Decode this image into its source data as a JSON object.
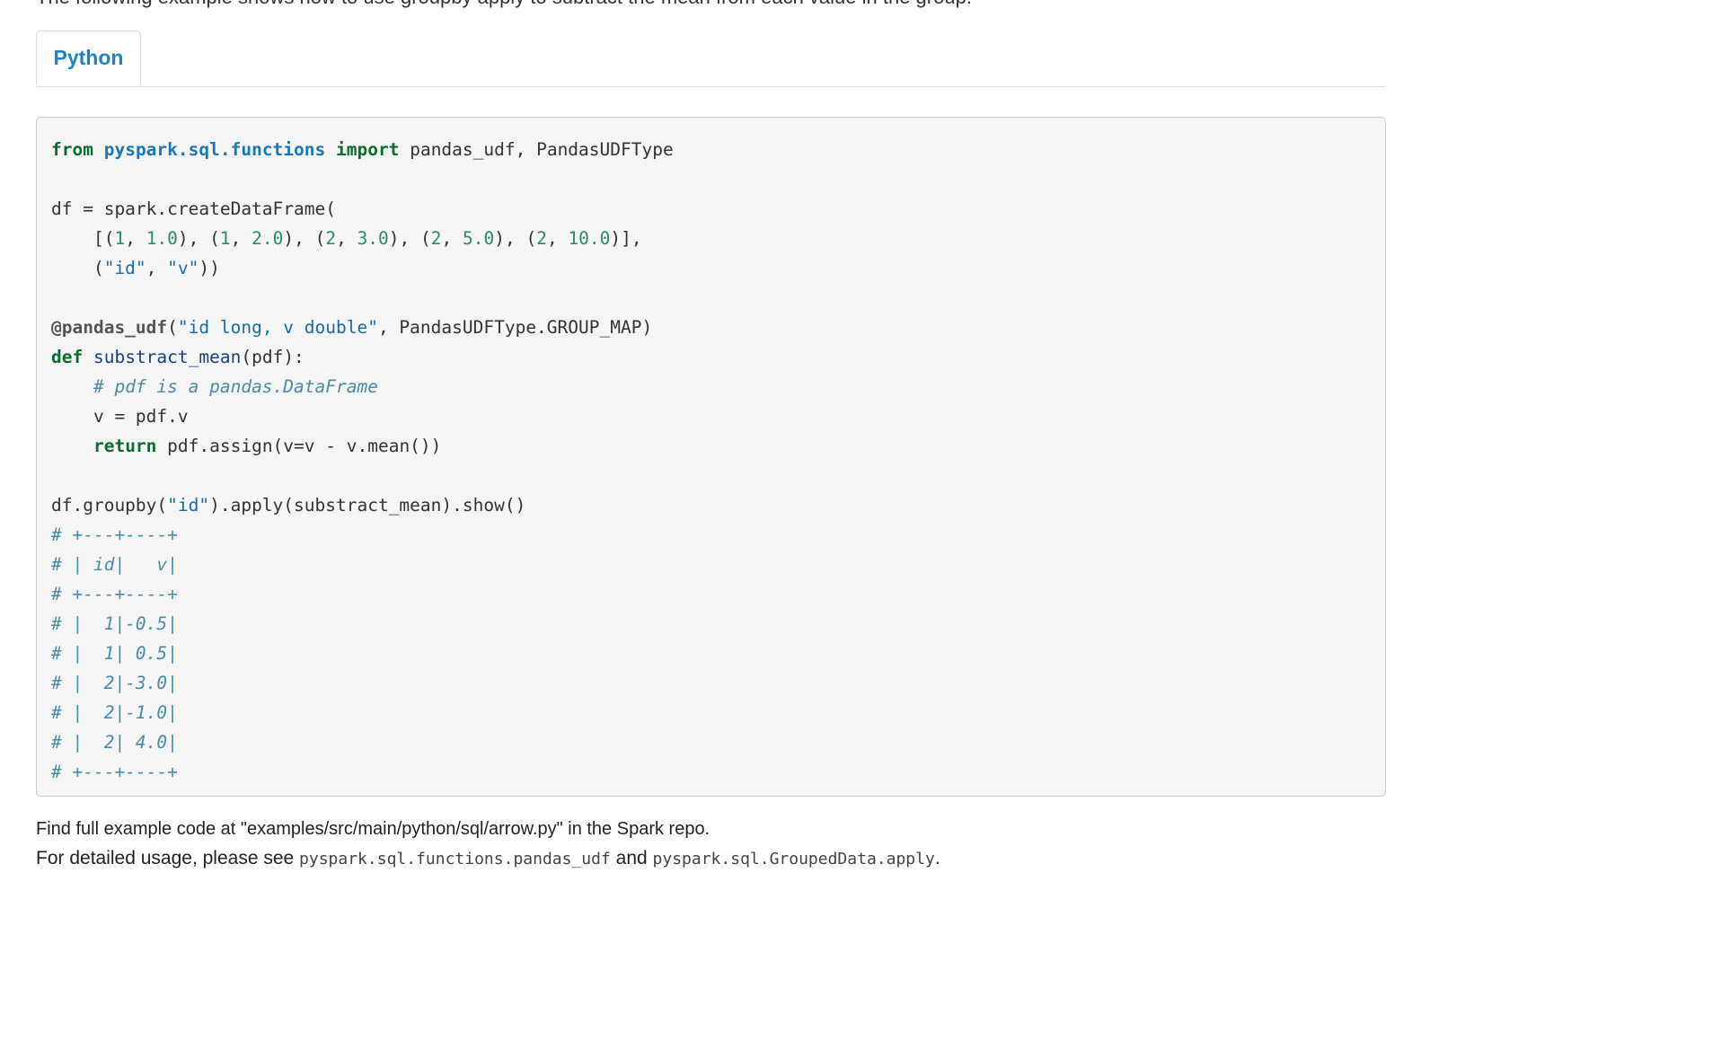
{
  "intro_text": "The following example shows how to use groupby apply to subtract the mean from each value in the group.",
  "tabs": [
    {
      "label": "Python",
      "active": true
    }
  ],
  "code": {
    "l1": {
      "kw_from": "from",
      "module": "pyspark.sql.functions",
      "kw_import": "import",
      "rest": " pandas_udf, PandasUDFType"
    },
    "l3": "df = spark.createDataFrame(",
    "l4": {
      "open": "    [(",
      "a1": "1",
      "sep1": ", ",
      "b1": "1.0",
      "c1": "), (",
      "a2": "1",
      "sep2": ", ",
      "b2": "2.0",
      "c2": "), (",
      "a3": "2",
      "sep3": ", ",
      "b3": "3.0",
      "c3": "), (",
      "a4": "2",
      "sep4": ", ",
      "b4": "5.0",
      "c4": "), (",
      "a5": "2",
      "sep5": ", ",
      "b5": "10.0",
      "close": ")],"
    },
    "l5": {
      "open": "    (",
      "s1": "\"id\"",
      "sep": ", ",
      "s2": "\"v\"",
      "close": "))"
    },
    "l7": {
      "decorator": "@pandas_udf",
      "open": "(",
      "str": "\"id long, v double\"",
      "rest": ", PandasUDFType.GROUP_MAP)"
    },
    "l8": {
      "kw": "def",
      "space": " ",
      "fn": "substract_mean",
      "rest": "(pdf):"
    },
    "l9": {
      "indent": "    ",
      "comment": "# pdf is a pandas.DataFrame"
    },
    "l10": "    v = pdf.v",
    "l11": {
      "indent": "    ",
      "kw": "return",
      "rest": " pdf.assign(v=v - v.mean())"
    },
    "l13": {
      "start": "df.groupby(",
      "str": "\"id\"",
      "rest": ").apply(substract_mean).show()"
    },
    "output_comments": [
      "# +---+----+",
      "# | id|   v|",
      "# +---+----+",
      "# |  1|-0.5|",
      "# |  1| 0.5|",
      "# |  2|-3.0|",
      "# |  2|-1.0|",
      "# |  2| 4.0|",
      "# +---+----+"
    ]
  },
  "footer": {
    "example_note": "Find full example code at \"examples/src/main/python/sql/arrow.py\" in the Spark repo.",
    "usage_prefix": "For detailed usage, please see ",
    "usage_code1": "pyspark.sql.functions.pandas_udf",
    "usage_and": " and ",
    "usage_code2": "pyspark.sql.GroupedData.apply",
    "usage_suffix": "."
  }
}
